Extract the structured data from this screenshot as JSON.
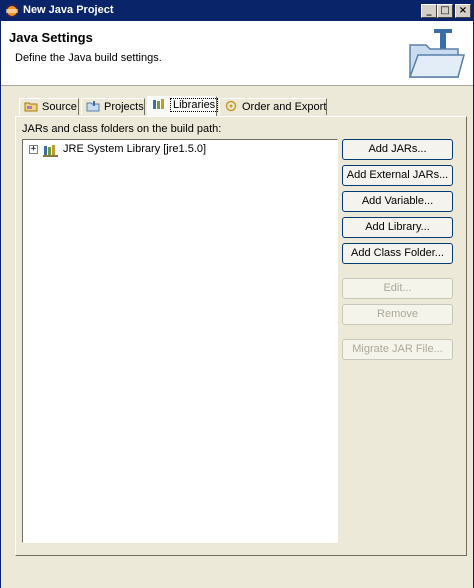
{
  "window": {
    "title": "New Java Project"
  },
  "title_buttons": {
    "minimize": "_",
    "maximize": "□",
    "close": "×"
  },
  "header": {
    "heading": "Java Settings",
    "description": "Define the Java build settings."
  },
  "tabs": [
    {
      "label": "Source",
      "icon": "source-folder-icon",
      "selected": false
    },
    {
      "label": "Projects",
      "icon": "projects-icon",
      "selected": false
    },
    {
      "label": "Libraries",
      "icon": "libraries-icon",
      "selected": true
    },
    {
      "label": "Order and Export",
      "icon": "order-export-icon",
      "selected": false
    }
  ],
  "libraries": {
    "build_path_label": "JARs and class folders on the build path:",
    "tree": [
      {
        "label": "JRE System Library [jre1.5.0]",
        "expander": "+",
        "icon": "library-icon"
      }
    ],
    "buttons": {
      "add_jars": "Add JARs...",
      "add_external_jars": "Add External JARs...",
      "add_variable": "Add Variable...",
      "add_library": "Add Library...",
      "add_class_folder": "Add Class Folder...",
      "edit": "Edit...",
      "remove": "Remove",
      "migrate_jar": "Migrate JAR File..."
    }
  }
}
